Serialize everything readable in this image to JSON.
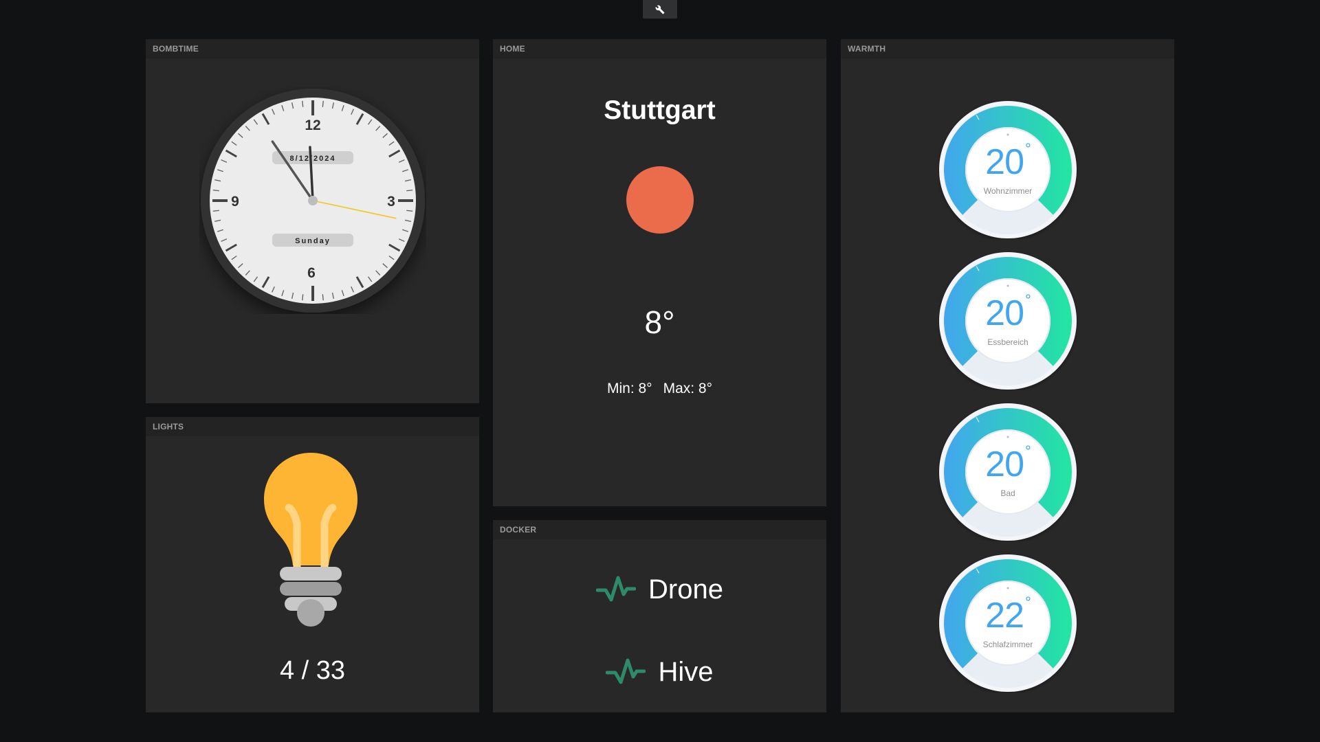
{
  "toolbar": {
    "settings_icon": "wrench-icon"
  },
  "panels": {
    "bombtime": {
      "title": "BOMBTIME"
    },
    "lights": {
      "title": "LIGHTS"
    },
    "home": {
      "title": "HOME"
    },
    "docker": {
      "title": "DOCKER"
    },
    "warmth": {
      "title": "WARMTH"
    }
  },
  "clock": {
    "numerals": {
      "n12": "12",
      "n3": "3",
      "n6": "6",
      "n9": "9"
    },
    "date": "8/12/2024",
    "weekday": "Sunday",
    "time": {
      "hour": 11,
      "minute": 54,
      "second": 17
    }
  },
  "weather": {
    "city": "Stuttgart",
    "temperature": "8°",
    "min": "Min: 8°",
    "max": "Max: 8°",
    "icon": "sun-icon",
    "sun_color": "#ea6c4a"
  },
  "lights": {
    "count": "4 / 33",
    "icon": "lightbulb-icon"
  },
  "docker": {
    "services": [
      {
        "name": "Drone",
        "icon": "pulse-icon"
      },
      {
        "name": "Hive",
        "icon": "pulse-icon"
      }
    ],
    "status_color": "#2e8b6a"
  },
  "thermostats": [
    {
      "value": "20",
      "degree": "°",
      "room": "Wohnzimmer"
    },
    {
      "value": "20",
      "degree": "°",
      "room": "Essbereich"
    },
    {
      "value": "20",
      "degree": "°",
      "room": "Bad"
    },
    {
      "value": "22",
      "degree": "°",
      "room": "Schlafzimmer"
    }
  ],
  "colors": {
    "background": "#111214",
    "panel": "#282828",
    "accent_blue": "#42a6ee",
    "accent_green": "#22e6a0",
    "second_hand": "#f5c518"
  }
}
